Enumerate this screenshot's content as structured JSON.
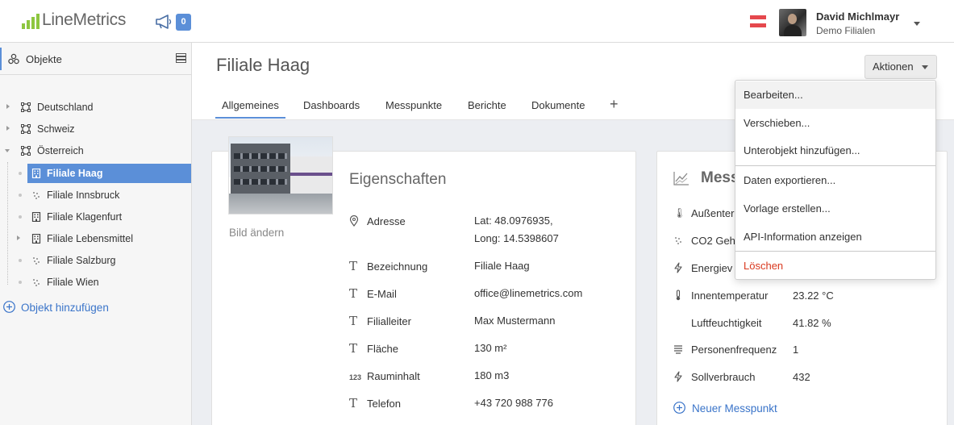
{
  "brand": {
    "name": "LineMetrics",
    "accent": "#8dc63f"
  },
  "header": {
    "notification_count": "0",
    "user_name": "David Michlmayr",
    "user_org": "Demo Filialen"
  },
  "sidebar": {
    "title": "Objekte",
    "items": [
      {
        "label": "Deutschland",
        "icon": "area-icon"
      },
      {
        "label": "Schweiz",
        "icon": "area-icon"
      },
      {
        "label": "Österreich",
        "icon": "area-icon"
      },
      {
        "label": "Filiale Haag",
        "icon": "building-icon",
        "active": true
      },
      {
        "label": "Filiale Innsbruck",
        "icon": "dots-icon"
      },
      {
        "label": "Filiale Klagenfurt",
        "icon": "building-icon"
      },
      {
        "label": "Filiale Lebensmittel",
        "icon": "building-icon"
      },
      {
        "label": "Filiale Salzburg",
        "icon": "dots-icon"
      },
      {
        "label": "Filiale Wien",
        "icon": "dots-icon"
      }
    ],
    "add_label": "Objekt hinzufügen"
  },
  "main": {
    "title": "Filiale Haag",
    "actions_label": "Aktionen",
    "tabs": [
      "Allgemeines",
      "Dashboards",
      "Messpunkte",
      "Berichte",
      "Dokumente"
    ],
    "tab_add": "+"
  },
  "properties": {
    "change_image": "Bild ändern",
    "title": "Eigenschaften",
    "rows": [
      {
        "icon": "location-icon",
        "key": "Adresse",
        "value": "Lat: 48.0976935,",
        "value2": "Long: 14.5398607"
      },
      {
        "icon": "text-icon",
        "key": "Bezeichnung",
        "value": "Filiale Haag"
      },
      {
        "icon": "text-icon",
        "key": "E-Mail",
        "value": "office@linemetrics.com"
      },
      {
        "icon": "text-icon",
        "key": "Filialleiter",
        "value": "Max Mustermann"
      },
      {
        "icon": "text-icon",
        "key": "Fläche",
        "value": "130 m²"
      },
      {
        "icon": "number-icon",
        "key": "Rauminhalt",
        "value": "180 m3"
      },
      {
        "icon": "text-icon",
        "key": "Telefon",
        "value": "+43 720 988 776"
      }
    ]
  },
  "measurements": {
    "title": "Mess",
    "rows": [
      {
        "icon": "thermometer-icon",
        "key": "Außenter",
        "value": ""
      },
      {
        "icon": "dots-icon",
        "key": "CO2 Geh",
        "value": ""
      },
      {
        "icon": "bolt-icon",
        "key": "Energiev",
        "value": ""
      },
      {
        "icon": "thermometer-icon",
        "key": "Innentemperatur",
        "value": "23.22 °C"
      },
      {
        "icon": "",
        "key": "Luftfeuchtigkeit",
        "value": "41.82 %"
      },
      {
        "icon": "list-icon",
        "key": "Personenfrequenz",
        "value": "1"
      },
      {
        "icon": "bolt-icon",
        "key": "Sollverbrauch",
        "value": "432"
      }
    ],
    "add_label": "Neuer Messpunkt"
  },
  "actions_menu": {
    "items": [
      "Bearbeiten...",
      "Verschieben...",
      "Unterobjekt hinzufügen...",
      "Daten exportieren...",
      "Vorlage erstellen...",
      "API-Information anzeigen",
      "Löschen"
    ]
  },
  "colors": {
    "primary": "#5b8fd8",
    "danger": "#d9381e",
    "link": "#3a74c9"
  }
}
